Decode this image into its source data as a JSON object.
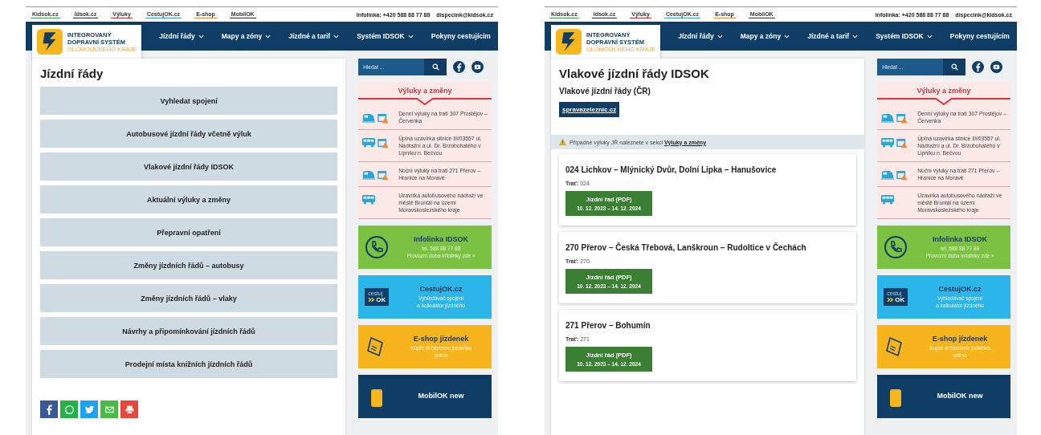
{
  "panels": [
    {
      "top_links": [
        {
          "label": "Kidsok.cz",
          "color": "#3aa757"
        },
        {
          "label": "Idsok.cz",
          "color": "#333333"
        },
        {
          "label": "Výluky",
          "color": "#d9333f"
        },
        {
          "label": "CestujOK.cz",
          "color": "#3aa0d8"
        },
        {
          "label": "E-shop",
          "color": "#f08a3a"
        },
        {
          "label": "MobilOK",
          "color": "#333333"
        }
      ],
      "contact": [
        "Infolinka: +420 588 88 77 88",
        "dispecink@kidsok.cz"
      ],
      "logo": {
        "lines": [
          "INTEGROVANÝ",
          "DOPRAVNÍ SYSTÉM",
          "OLOMOUCKÉHO KRAJE"
        ]
      },
      "nav": [
        {
          "label": "Jízdní řády",
          "has_menu": true
        },
        {
          "label": "Mapy a zóny",
          "has_menu": true
        },
        {
          "label": "Jízdné a tarif",
          "has_menu": true
        },
        {
          "label": "Systém IDSOK",
          "has_menu": true
        },
        {
          "label": "Pokyny cestujícím",
          "has_menu": false
        }
      ],
      "main": {
        "kind": "menu",
        "title": "Jízdní řády",
        "items": [
          "Vyhledat spojení",
          "Autobusové jízdní řády včetně výluk",
          "Vlakové jízdní řády IDSOK",
          "Aktuální výluky a změny",
          "Přepravní opatření",
          "Změny jízdních řádů – autobusy",
          "Změny jízdních řádů – vlaky",
          "Návrhy a připomínkování jízdních řádů",
          "Prodejní místa knižních jízdních řádů"
        ],
        "share": [
          {
            "kind": "facebook"
          },
          {
            "kind": "whatsapp"
          },
          {
            "kind": "twitter"
          },
          {
            "kind": "email"
          },
          {
            "kind": "print"
          }
        ]
      },
      "sidebar": {
        "search": {
          "placeholder": "Hledat ..."
        },
        "outages": {
          "title": "Výluky a změny",
          "items": [
            {
              "kind": "train",
              "calendar": true,
              "text": "Denní výluky na trati 307 Prostějov – Červenka"
            },
            {
              "kind": "bus",
              "calendar": true,
              "text": "Úplná uzavírka silnice III/03557 ul. Nádražní a ul. Dr. Brzobohatého v Lipníku n. Bečvou"
            },
            {
              "kind": "train",
              "calendar": true,
              "text": "Noční výluky na trati 271 Přerov – Hranice na Moravě"
            },
            {
              "kind": "bus",
              "calendar": false,
              "text": "Uzavírka autobusového nádraží ve městě Bruntál na území Moravskoslezského kraje"
            }
          ]
        },
        "promos": [
          {
            "kind": "phone",
            "title": "Infolinka IDSOK",
            "lines": [
              "tel. 588 88 77 88",
              "Provozní doba infolinky zde »"
            ]
          },
          {
            "kind": "cestuj",
            "title": "CestujOK.cz",
            "logo": [
              "cestuj",
              "OK"
            ],
            "lines": [
              "Vyhledávač spojení",
              "a kalkulátor jízdného"
            ]
          },
          {
            "kind": "eshop",
            "title": "E-shop jízdenek",
            "lines": [
              "Kupte si časovou jízdenku",
              "online"
            ]
          },
          {
            "kind": "mobil",
            "title": "MobilOK new"
          }
        ]
      }
    },
    {
      "top_links": [
        {
          "label": "Kidsok.cz",
          "color": "#3aa757"
        },
        {
          "label": "Idsok.cz",
          "color": "#333333"
        },
        {
          "label": "Výluky",
          "color": "#d9333f"
        },
        {
          "label": "CestujOK.cz",
          "color": "#3aa0d8"
        },
        {
          "label": "E-shop",
          "color": "#f08a3a"
        },
        {
          "label": "MobilOK",
          "color": "#333333"
        }
      ],
      "contact": [
        "Infolinka: +420 588 88 77 88",
        "dispecink@kidsok.cz"
      ],
      "logo": {
        "lines": [
          "INTEGROVANÝ",
          "DOPRAVNÍ SYSTÉM",
          "OLOMOUCKÉHO KRAJE"
        ]
      },
      "nav": [
        {
          "label": "Jízdní řády",
          "has_menu": true
        },
        {
          "label": "Mapy a zóny",
          "has_menu": true
        },
        {
          "label": "Jízdné a tarif",
          "has_menu": true
        },
        {
          "label": "Systém IDSOK",
          "has_menu": true
        },
        {
          "label": "Pokyny cestujícím",
          "has_menu": false
        }
      ],
      "main": {
        "kind": "timetables",
        "title": "Vlakové jízdní řády IDSOK",
        "subtitle": "Vlakové jízdní řády (ČR)",
        "link_button": "spravazeleznic.cz",
        "notice": {
          "text": "Případné výluky JŘ naleznete v sekci",
          "link": "Výluky a změny"
        },
        "cards": [
          {
            "title": "024 Lichkov – Mlýnický Dvůr, Dolní Lipka – Hanušovice",
            "track_label": "Trať:",
            "track": "024",
            "button": "Jízdní řád (PDF)",
            "dates": "10. 12. 2023 – 14. 12. 2024"
          },
          {
            "title": "270 Přerov – Česká Třebová, Lanškroun – Rudoltice v Čechách",
            "track_label": "Trať:",
            "track": "270",
            "button": "Jízdní řád (PDF)",
            "dates": "10. 12. 2023 – 14. 12. 2024"
          },
          {
            "title": "271 Přerov – Bohumín",
            "track_label": "Trať:",
            "track": "271",
            "button": "Jízdní řád (PDF)",
            "dates": "10. 12. 2023 – 14. 12. 2024"
          }
        ]
      },
      "sidebar": {
        "search": {
          "placeholder": "Hledat ..."
        },
        "outages": {
          "title": "Výluky a změny",
          "items": [
            {
              "kind": "train",
              "calendar": true,
              "text": "Denní výluky na trati 307 Prostějov – Červenka"
            },
            {
              "kind": "bus",
              "calendar": true,
              "text": "Úplná uzavírka silnice III/03557 ul. Nádražní a ul. Dr. Brzobohatého v Lipníku n. Bečvou"
            },
            {
              "kind": "train",
              "calendar": true,
              "text": "Noční výluky na trati 271 Přerov – Hranice na Moravě"
            },
            {
              "kind": "bus",
              "calendar": false,
              "text": "Uzavírka autobusového nádraží ve městě Bruntál na území Moravskoslezského kraje"
            }
          ]
        },
        "promos": [
          {
            "kind": "phone",
            "title": "Infolinka IDSOK",
            "lines": [
              "tel. 588 88 77 88",
              "Provozní doba infolinky zde »"
            ]
          },
          {
            "kind": "cestuj",
            "title": "CestujOK.cz",
            "logo": [
              "cestuj",
              "OK"
            ],
            "lines": [
              "Vyhledávač spojení",
              "a kalkulátor jízdného"
            ]
          },
          {
            "kind": "eshop",
            "title": "E-shop jízdenek",
            "lines": [
              "Kupte si časovou jízdenku",
              "online"
            ]
          },
          {
            "kind": "mobil",
            "title": "MobilOK new"
          }
        ]
      }
    }
  ]
}
